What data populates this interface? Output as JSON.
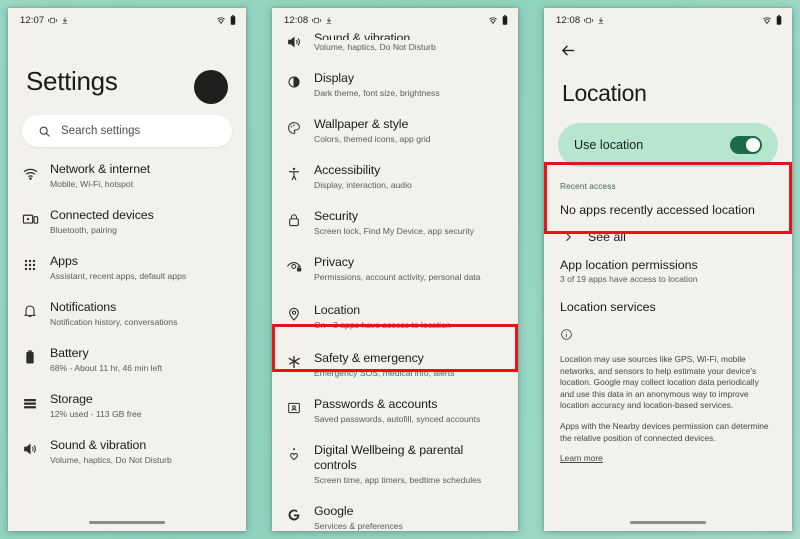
{
  "background_color": "#92d3bf",
  "accent_red": "#e8131a",
  "phones": {
    "settings_home": {
      "status_bar": {
        "time": "12:07",
        "icons": [
          "vibrate-icon",
          "download-icon",
          "wifi-icon",
          "battery-icon"
        ]
      },
      "page_title": "Settings",
      "avatar": "account-avatar",
      "search": {
        "placeholder": "Search settings",
        "icon": "search-icon"
      },
      "items": [
        {
          "icon": "wifi-icon",
          "title": "Network & internet",
          "subtitle": "Mobile, Wi-Fi, hotspot"
        },
        {
          "icon": "connected-devices-icon",
          "title": "Connected devices",
          "subtitle": "Bluetooth, pairing"
        },
        {
          "icon": "apps-grid-icon",
          "title": "Apps",
          "subtitle": "Assistant, recent apps, default apps"
        },
        {
          "icon": "bell-icon",
          "title": "Notifications",
          "subtitle": "Notification history, conversations"
        },
        {
          "icon": "battery-icon",
          "title": "Battery",
          "subtitle": "68% - About 11 hr, 46 min left"
        },
        {
          "icon": "storage-icon",
          "title": "Storage",
          "subtitle": "12% used - 113 GB free"
        },
        {
          "icon": "volume-icon",
          "title": "Sound & vibration",
          "subtitle": "Volume, haptics, Do Not Disturb"
        }
      ]
    },
    "settings_scrolled": {
      "status_bar": {
        "time": "12:08",
        "icons": [
          "vibrate-icon",
          "download-icon",
          "wifi-icon",
          "battery-icon"
        ]
      },
      "items": [
        {
          "icon": "volume-icon",
          "title": "Sound & vibration",
          "subtitle": "Volume, haptics, Do Not Disturb"
        },
        {
          "icon": "display-icon",
          "title": "Display",
          "subtitle": "Dark theme, font size, brightness"
        },
        {
          "icon": "palette-icon",
          "title": "Wallpaper & style",
          "subtitle": "Colors, themed icons, app grid"
        },
        {
          "icon": "accessibility-icon",
          "title": "Accessibility",
          "subtitle": "Display, interaction, audio"
        },
        {
          "icon": "lock-icon",
          "title": "Security",
          "subtitle": "Screen lock, Find My Device, app security"
        },
        {
          "icon": "privacy-eye-icon",
          "title": "Privacy",
          "subtitle": "Permissions, account activity, personal data"
        },
        {
          "icon": "location-pin-icon",
          "title": "Location",
          "subtitle": "On - 3 apps have access to location",
          "highlighted": true
        },
        {
          "icon": "safety-icon",
          "title": "Safety & emergency",
          "subtitle": "Emergency SOS, medical info, alerts"
        },
        {
          "icon": "passwords-icon",
          "title": "Passwords & accounts",
          "subtitle": "Saved passwords, autofill, synced accounts"
        },
        {
          "icon": "wellbeing-icon",
          "title": "Digital Wellbeing & parental controls",
          "subtitle": "Screen time, app timers, bedtime schedules"
        },
        {
          "icon": "google-g-icon",
          "title": "Google",
          "subtitle": "Services & preferences"
        }
      ]
    },
    "location_page": {
      "status_bar": {
        "time": "12:08",
        "icons": [
          "vibrate-icon",
          "download-icon",
          "wifi-icon",
          "battery-icon"
        ]
      },
      "back": "back-arrow-icon",
      "page_title": "Location",
      "use_location": {
        "label": "Use location",
        "state": "on",
        "highlighted": true
      },
      "recent_access_label": "Recent access",
      "no_apps_text": "No apps recently accessed location",
      "see_all": {
        "label": "See all",
        "icon": "chevron-right-icon"
      },
      "app_permissions": {
        "title": "App location permissions",
        "subtitle": "3 of 19 apps have access to location"
      },
      "location_services": "Location services",
      "info_icon": "info-icon",
      "info_paragraph_1": "Location may use sources like GPS, Wi-Fi, mobile networks, and sensors to help estimate your device's location. Google may collect location data periodically and use this data in an anonymous way to improve location accuracy and location-based services.",
      "info_paragraph_2": "Apps with the Nearby devices permission can determine the relative position of connected devices.",
      "learn_more": "Learn more"
    }
  }
}
